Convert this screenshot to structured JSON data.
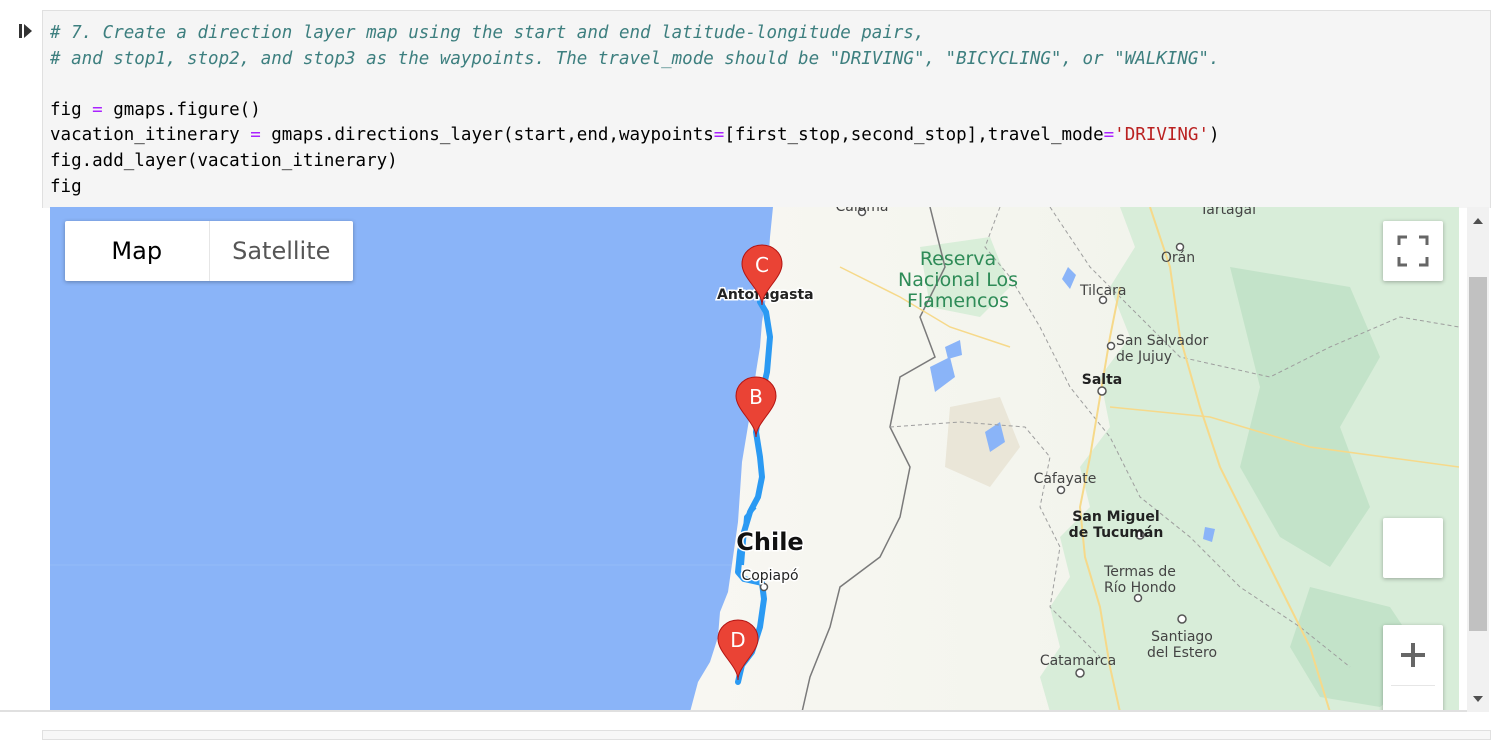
{
  "notebook": {
    "code_lines": [
      [
        {
          "t": "# 7. Create a direction layer map using the start and end latitude-longitude pairs,",
          "c": "cm-comment"
        }
      ],
      [
        {
          "t": "# and stop1, stop2, and stop3 as the waypoints. The travel_mode should be \"DRIVING\", \"BICYCLING\", or \"WALKING\".",
          "c": "cm-comment"
        }
      ],
      [
        {
          "t": "",
          "c": ""
        }
      ],
      [
        {
          "t": "fig ",
          "c": ""
        },
        {
          "t": "=",
          "c": "cm-op"
        },
        {
          "t": " gmaps.figure()",
          "c": ""
        }
      ],
      [
        {
          "t": "vacation_itinerary ",
          "c": ""
        },
        {
          "t": "=",
          "c": "cm-op"
        },
        {
          "t": " gmaps.directions_layer(start,end,waypoints",
          "c": ""
        },
        {
          "t": "=",
          "c": "cm-op"
        },
        {
          "t": "[first_stop,second_stop],travel_mode",
          "c": ""
        },
        {
          "t": "=",
          "c": "cm-op"
        },
        {
          "t": "'DRIVING'",
          "c": "cm-str"
        },
        {
          "t": ")",
          "c": ""
        }
      ],
      [
        {
          "t": "fig.add_layer(vacation_itinerary)",
          "c": ""
        }
      ],
      [
        {
          "t": "fig",
          "c": ""
        }
      ]
    ]
  },
  "map": {
    "map_type_buttons": [
      "Map",
      "Satellite"
    ],
    "active_map_type": "Map",
    "markers": [
      "C",
      "B",
      "D"
    ],
    "labels": {
      "calama": "Calama",
      "tartagal": "Tartagal",
      "reserva1": "Reserva",
      "reserva2": "Nacional Los",
      "reserva3": "Flamencos",
      "oran": "Orán",
      "antofagasta": "Antofagasta",
      "tilcara": "Tilcara",
      "san_salvador1": "San Salvador",
      "san_salvador2": "de Jujuy",
      "salta": "Salta",
      "cafayate": "Cafayate",
      "san_miguel1": "San Miguel",
      "san_miguel2": "de Tucumán",
      "chile": "Chile",
      "copiapo": "Copiapó",
      "termas1": "Termas de",
      "termas2": "Río Hondo",
      "santiago1": "Santiago",
      "santiago2": "del Estero",
      "catamarca": "Catamarca"
    },
    "colors": {
      "water": "#8ab4f8",
      "land": "#f8f7f2",
      "green": "#ccebd4",
      "route": "#2b9af3",
      "marker": "#ea4335"
    },
    "icons": {
      "fullscreen": "fullscreen-icon",
      "zoom_in": "plus-icon"
    }
  }
}
